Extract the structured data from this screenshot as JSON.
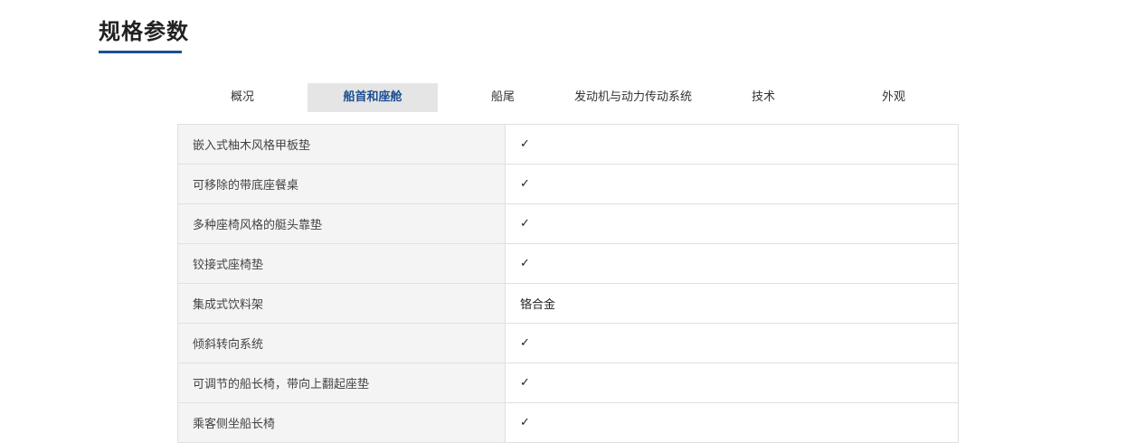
{
  "section": {
    "title": "规格参数",
    "accent_color": "#1d4f91"
  },
  "tabs": [
    {
      "label": "概况",
      "active": false
    },
    {
      "label": "船首和座舱",
      "active": true
    },
    {
      "label": "船尾",
      "active": false
    },
    {
      "label": "发动机与动力传动系统",
      "active": false
    },
    {
      "label": "技术",
      "active": false
    },
    {
      "label": "外观",
      "active": false
    }
  ],
  "specs": [
    {
      "label": "嵌入式柚木风格甲板垫",
      "value": "✓"
    },
    {
      "label": "可移除的带底座餐桌",
      "value": "✓"
    },
    {
      "label": "多种座椅风格的艇头靠垫",
      "value": "✓"
    },
    {
      "label": "铰接式座椅垫",
      "value": "✓"
    },
    {
      "label": "集成式饮料架",
      "value": "铬合金"
    },
    {
      "label": "倾斜转向系统",
      "value": "✓"
    },
    {
      "label": "可调节的船长椅，带向上翻起座垫",
      "value": "✓"
    },
    {
      "label": "乘客侧坐船长椅",
      "value": "✓"
    }
  ]
}
